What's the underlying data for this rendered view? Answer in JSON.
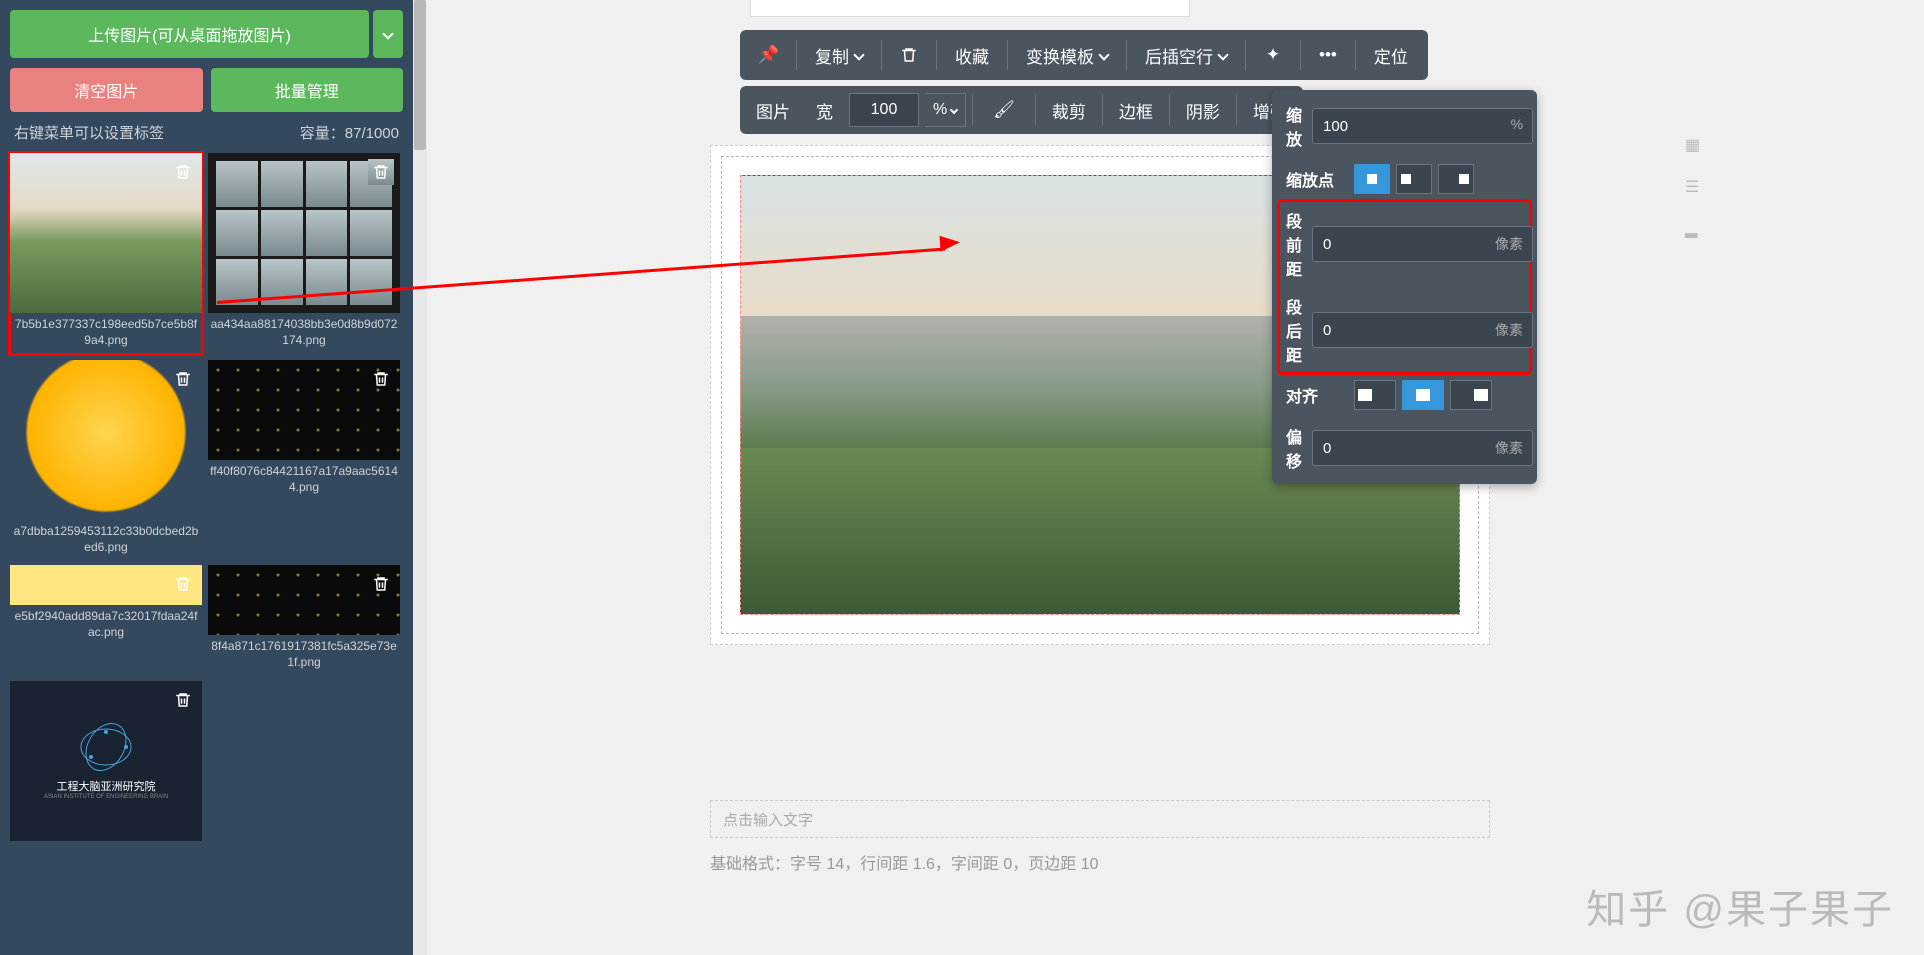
{
  "sidebar": {
    "upload_label": "上传图片(可从桌面拖放图片)",
    "clear_label": "清空图片",
    "batch_label": "批量管理",
    "hint": "右键菜单可以设置标签",
    "capacity": "容量：87/1000",
    "thumbs": [
      {
        "name": "7b5b1e377337c198eed5b7ce5b8f9a4.png",
        "cls": "landscape",
        "selected": true
      },
      {
        "name": "aa434aa88174038bb3e0d8b9d072174.png",
        "cls": "window-grid"
      },
      {
        "name": "a7dbba1259453112c33b0dcbed2bed6.png",
        "cls": "emoji-face"
      },
      {
        "name": "ff40f8076c84421167a17a9aac56144.png",
        "cls": "dots-dark"
      },
      {
        "name": "e5bf2940add89da7c32017fdaa24fac.png",
        "cls": "yellow-bar"
      },
      {
        "name": "8f4a871c1761917381fc5a325e73e1f.png",
        "cls": "dots-dark"
      },
      {
        "name": "",
        "cls": "logo-inst"
      }
    ],
    "logo_text1": "工程大脑亚洲研究院",
    "logo_text2": "ASIAN INSTITUTE OF ENGINEERING BRAIN"
  },
  "toolbar1": {
    "copy": "复制",
    "fav": "收藏",
    "template": "变换模板",
    "insert": "后插空行",
    "locate": "定位"
  },
  "toolbar2": {
    "image": "图片",
    "width": "宽",
    "width_val": "100",
    "unit": "%",
    "crop": "裁剪",
    "border": "边框",
    "shadow": "阴影",
    "enhance": "增强"
  },
  "props": {
    "scale_label": "缩放",
    "scale_val": "100",
    "scale_unit": "%",
    "anchor_label": "缩放点",
    "margin_top_label": "段前距",
    "margin_top_val": "0",
    "margin_bot_label": "段后距",
    "margin_bot_val": "0",
    "pixel_unit": "像素",
    "align_label": "对齐",
    "offset_label": "偏移",
    "offset_val": "0"
  },
  "caption_placeholder": "点击输入文字",
  "format_text": "基础格式：字号 14，行间距 1.6，字间距 0，页边距 10",
  "watermark": "知乎 @果子果子"
}
